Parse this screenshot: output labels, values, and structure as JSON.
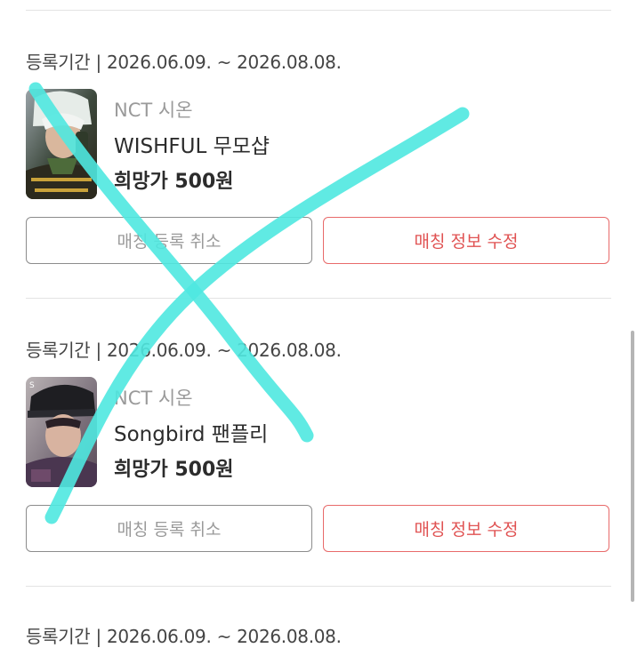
{
  "listings": [
    {
      "period_label": "등록기간 | 2026.06.09. ~ 2026.08.08.",
      "group": "NCT 시온",
      "item": "WISHFUL 무모샵",
      "price": "희망가 500원",
      "cancel_label": "매칭 등록 취소",
      "edit_label": "매칭 정보 수정"
    },
    {
      "period_label": "등록기간 | 2026.06.09. ~ 2026.08.08.",
      "group": "NCT 시온",
      "item": "Songbird 팬플리",
      "price": "희망가 500원",
      "cancel_label": "매칭 등록 취소",
      "edit_label": "매칭 정보 수정"
    },
    {
      "period_label": "등록기간 | 2026.06.09. ~ 2026.08.08."
    }
  ],
  "colors": {
    "accent_red": "#e05252",
    "overlay_cyan": "#4fe8e0",
    "muted_gray": "#9a9a9a"
  }
}
